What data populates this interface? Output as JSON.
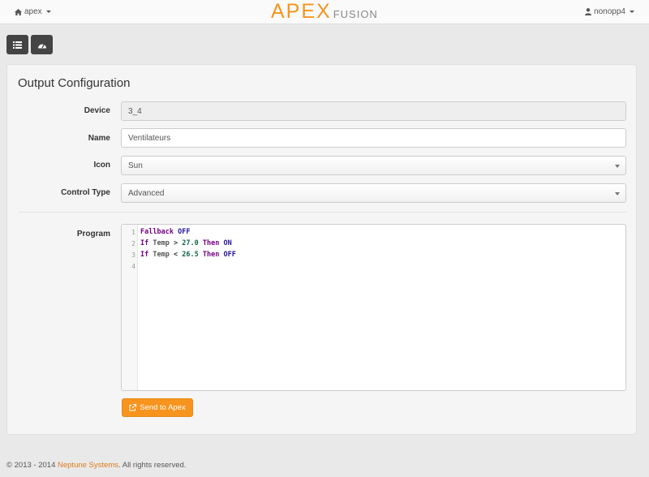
{
  "header": {
    "home_label": "apex",
    "logo_main": "APEX",
    "logo_sub": "FUSION",
    "user_label": "nonopp4"
  },
  "toolbar": {
    "list_icon": "list-icon",
    "dashboard_icon": "dashboard-icon"
  },
  "panel": {
    "title": "Output Configuration",
    "device_label": "Device",
    "device_value": "3_4",
    "name_label": "Name",
    "name_value": "Ventilateurs",
    "icon_label": "Icon",
    "icon_value": "Sun",
    "control_type_label": "Control Type",
    "control_type_value": "Advanced",
    "program_label": "Program",
    "program": {
      "line_numbers": [
        "1",
        "2",
        "3",
        "4"
      ],
      "lines": [
        "Fallback OFF",
        "If Temp > 27.0 Then ON",
        "If Temp < 26.5 Then OFF",
        ""
      ]
    },
    "send_label": "Send to Apex"
  },
  "footer": {
    "prefix": "© 2013 - 2014 ",
    "brand": "Neptune Systems",
    "suffix": ". All rights reserved."
  },
  "colors": {
    "accent": "#f7941d",
    "keyword": "#770088",
    "value": "#221199",
    "number": "#116644"
  }
}
